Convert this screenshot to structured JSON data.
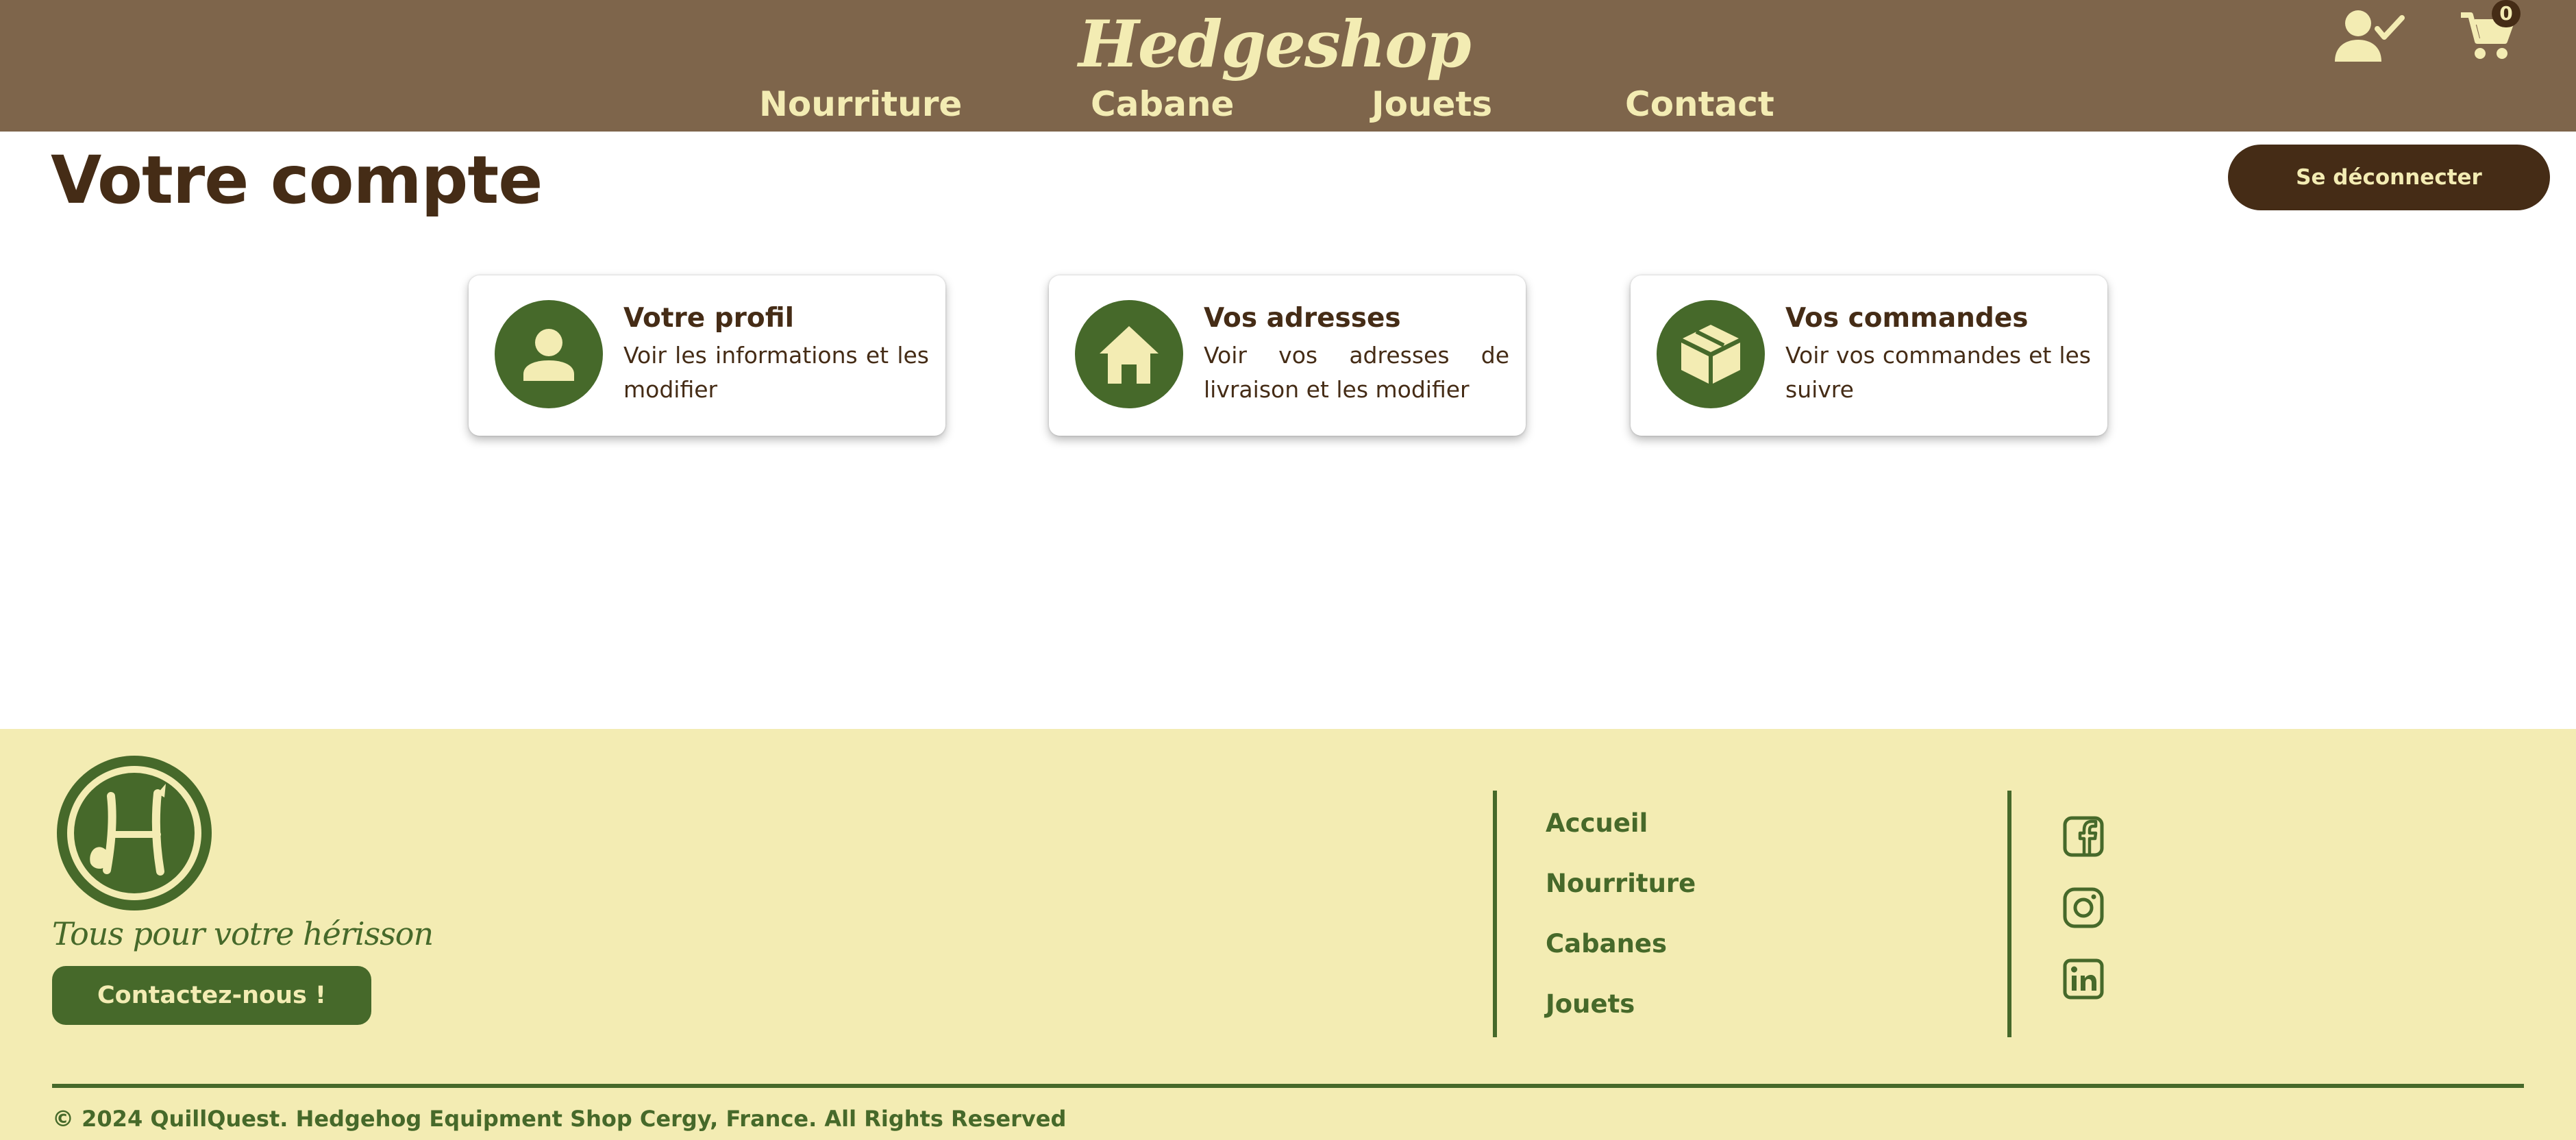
{
  "header": {
    "logo_text": "Hedgeshop",
    "nav": [
      "Nourriture",
      "Cabane",
      "Jouets",
      "Contact"
    ],
    "account_icon": "account-verified-icon",
    "cart_icon": "cart-icon",
    "cart_count": "0"
  },
  "main": {
    "title": "Votre compte",
    "logout_label": "Se déconnecter",
    "cards": [
      {
        "icon": "person-icon",
        "title": "Votre profil",
        "description": "Voir les informations et les modifier"
      },
      {
        "icon": "house-icon",
        "title": "Vos adresses",
        "description": "Voir vos adresses de livraison et les modifier"
      },
      {
        "icon": "package-icon",
        "title": "Vos commandes",
        "description": "Voir vos commandes et les suivre"
      }
    ]
  },
  "footer": {
    "logo_icon": "hedgeshop-badge-logo",
    "tagline": "Tous pour votre hérisson",
    "contact_label": "Contactez-nous !",
    "links": [
      "Accueil",
      "Nourriture",
      "Cabanes",
      "Jouets"
    ],
    "social_icons": [
      "facebook-icon",
      "instagram-icon",
      "linkedin-icon"
    ],
    "copyright": "© 2024 QuillQuest. Hedgehog Equipment Shop Cergy, France. All Rights Reserved"
  },
  "colors": {
    "header_bg": "#7e654b",
    "cream": "#f3ecb3",
    "dark_brown": "#452c16",
    "green": "#46692a"
  }
}
